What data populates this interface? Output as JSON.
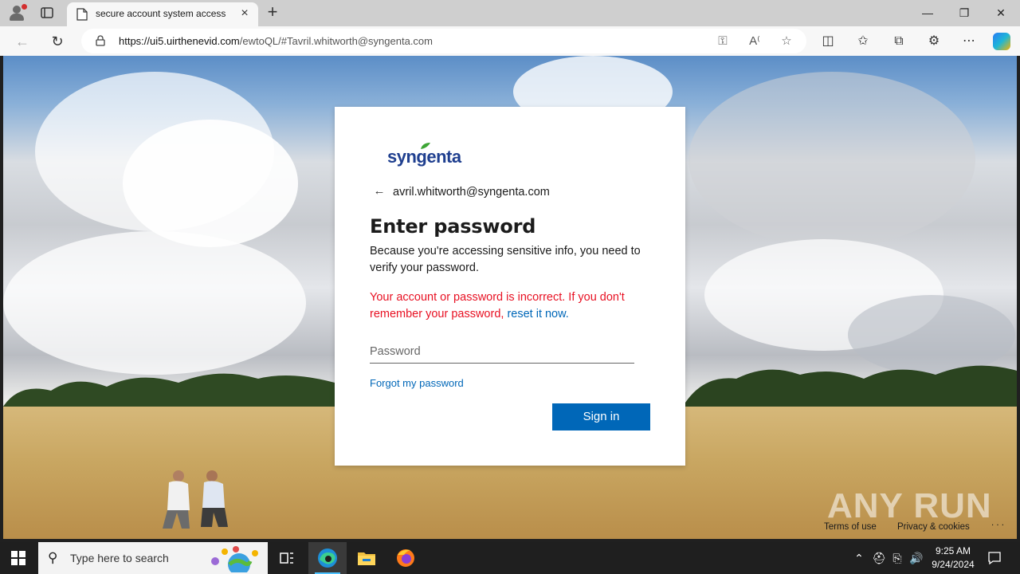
{
  "browser": {
    "tab_title": "secure account system access",
    "new_tab_symbol": "+",
    "close_symbol": "×",
    "url_host": "https://ui5.uirthenevid.com",
    "url_path": "/ewtoQL/#Tavril.whitworth@syngenta.com",
    "icons": [
      "profile-icon",
      "tab-actions-icon",
      "back-icon",
      "refresh-icon",
      "lock-icon",
      "key-icon",
      "read-aloud-icon",
      "favorite-star-icon",
      "split-screen-icon",
      "favorites-icon",
      "collections-icon",
      "extensions-icon",
      "more-icon",
      "copilot-icon"
    ]
  },
  "login": {
    "logo": "syngenta",
    "identity": "avril.whitworth@syngenta.com",
    "heading": "Enter password",
    "description": "Because you're accessing sensitive info, you need to verify your password.",
    "error_text": "Your account or password is incorrect. If you don't remember your password, ",
    "error_link": "reset it now.",
    "password_placeholder": "Password",
    "forgot_link": "Forgot my password",
    "signin_label": "Sign in"
  },
  "footer": {
    "terms": "Terms of use",
    "privacy": "Privacy & cookies",
    "more": ". . ."
  },
  "watermark": "ANY RUN",
  "taskbar": {
    "search_placeholder": "Type here to search",
    "time": "9:25 AM",
    "date": "9/24/2024",
    "accent": "#4cc2ff"
  }
}
